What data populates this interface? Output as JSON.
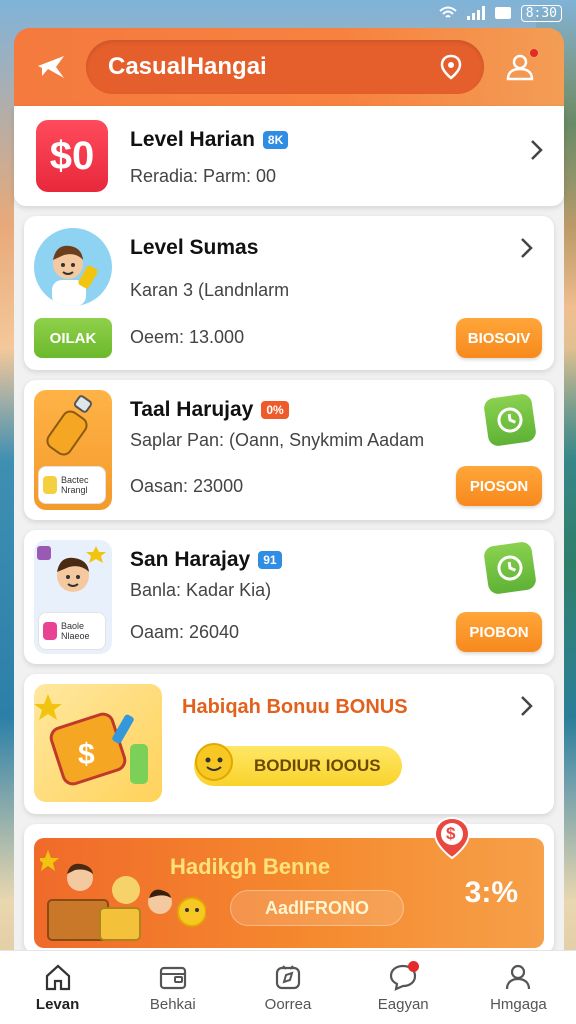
{
  "status_bar": {
    "time": "8:30"
  },
  "header": {
    "search_value": "CasualHangai",
    "accent": "#f47a3e"
  },
  "items": [
    {
      "title": "Level Harian",
      "tag": "8K",
      "tag_color": "#2f8de4",
      "subtitle": "Reradia: Parm: 00",
      "thumb_text": "$0"
    },
    {
      "title": "Level Sumas",
      "subtitle": "Karan 3 (Landnlarm",
      "green_button": "OILAK",
      "amount": "Oeem: 13.000",
      "action": "BIOSOIV"
    },
    {
      "title": "Taal Harujay",
      "tag": "0%",
      "tag_color": "#ef5a2b",
      "subtitle": "Saplar Pan: (Oann, Snykmim Aadam",
      "badge_text": "Bactec Nrangl",
      "amount": "Oasan: 23000",
      "action": "PIOSON"
    },
    {
      "title": "San Harajay",
      "tag": "91",
      "tag_color": "#2f8de4",
      "subtitle": "Banla: Kadar Kia)",
      "badge_text": "Baole Nlaeoe",
      "amount": "Oaam: 26040",
      "action": "PIOBON"
    }
  ],
  "bonus": {
    "title": "Habiqah Bonuu BONUS",
    "pill": "BODIUR IOOUS"
  },
  "promo": {
    "title": "Hadikgh Benne",
    "pill": "AadlFRONO",
    "percent": "3:%",
    "pin": "$"
  },
  "nav": [
    {
      "label": "Levan",
      "icon": "home-icon"
    },
    {
      "label": "Behkai",
      "icon": "wallet-icon"
    },
    {
      "label": "Oorrea",
      "icon": "compass-icon"
    },
    {
      "label": "Eagyan",
      "icon": "chat-icon"
    },
    {
      "label": "Hmgaga",
      "icon": "user-icon"
    }
  ]
}
